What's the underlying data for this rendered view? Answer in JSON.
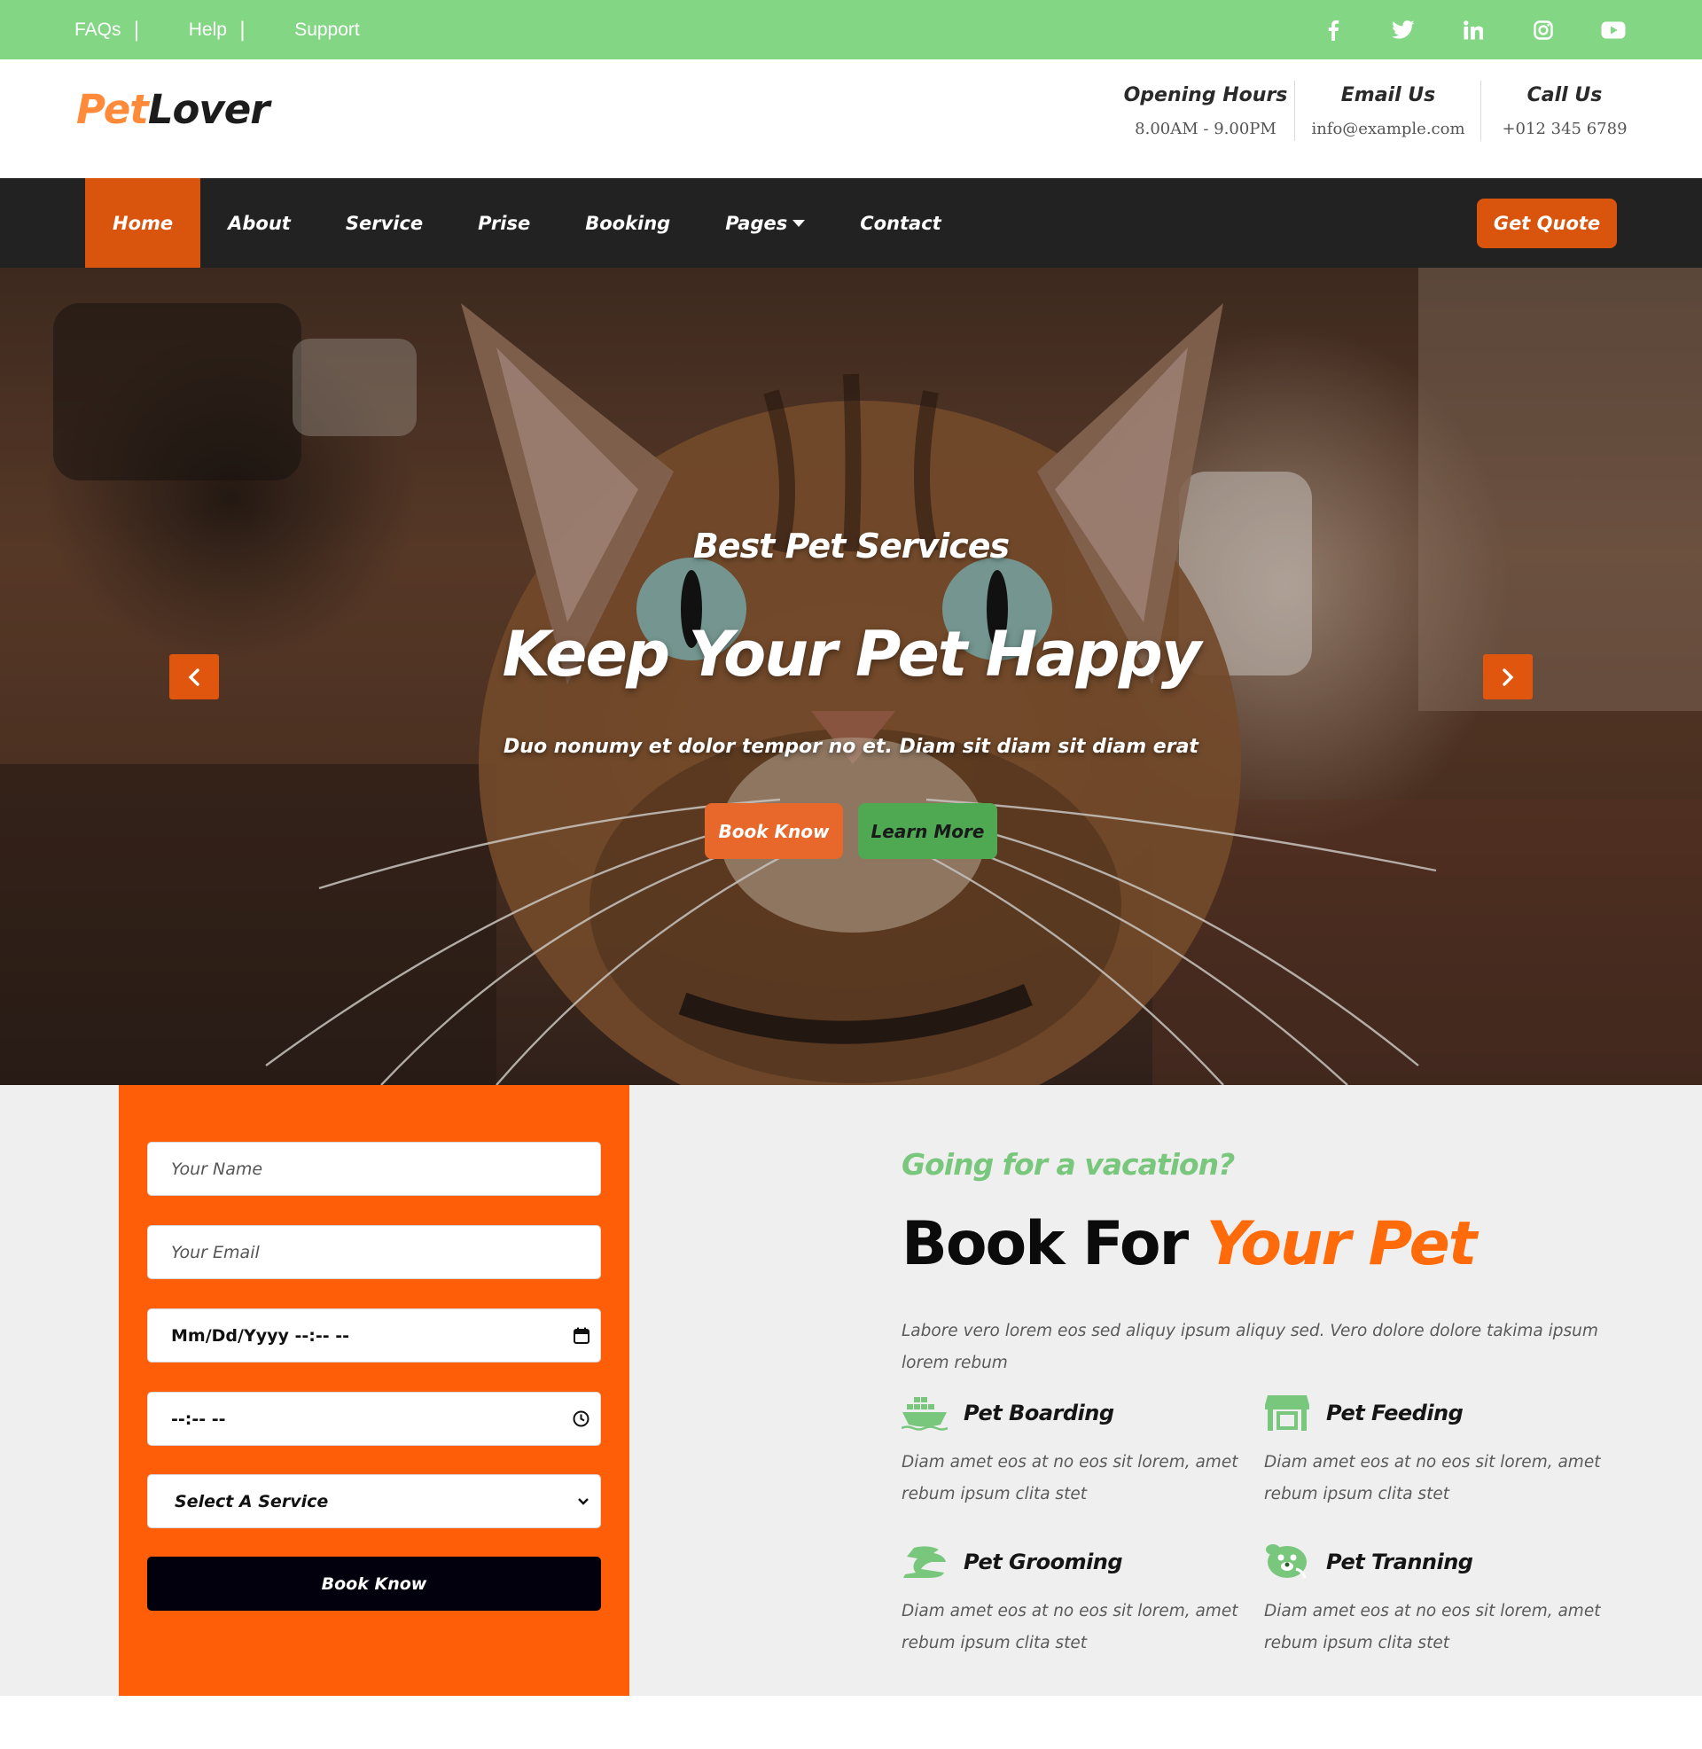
{
  "topbar": {
    "links": [
      "FAQs",
      "Help",
      "Support"
    ],
    "social_icons": [
      "facebook-icon",
      "twitter-icon",
      "linkedin-icon",
      "instagram-icon",
      "youtube-icon"
    ]
  },
  "header": {
    "logo_part1": "Pet",
    "logo_part2": "Lover",
    "contacts": [
      {
        "title": "Opening Hours",
        "value": "8.00AM - 9.00PM"
      },
      {
        "title": "Email Us",
        "value": "info@example.com"
      },
      {
        "title": "Call Us",
        "value": "+012 345 6789"
      }
    ]
  },
  "nav": {
    "items": [
      "Home",
      "About",
      "Service",
      "Prise",
      "Booking",
      "Pages",
      "Contact"
    ],
    "active": "Home",
    "quote_button": "Get Quote"
  },
  "hero": {
    "subtitle": "Best Pet Services",
    "title": "Keep Your Pet Happy",
    "description": "Duo nonumy et dolor tempor no et. Diam sit diam sit diam erat",
    "book_button": "Book Know",
    "learn_button": "Learn More"
  },
  "booking_form": {
    "name_placeholder": "Your Name",
    "email_placeholder": "Your Email",
    "date_value": "Mm/Dd/Yyyy --:-- --",
    "time_value": "--:-- --",
    "service_select": "Select A Service",
    "submit_button": "Book Know"
  },
  "booking_info": {
    "label": "Going for a vacation?",
    "title_part1": "Book For",
    "title_part2": "Your Pet",
    "description": "Labore vero lorem eos sed aliquy ipsum aliquy sed. Vero dolore dolore takima ipsum lorem rebum",
    "features": [
      {
        "title": "Pet Boarding",
        "icon": "ship-icon",
        "desc": "Diam amet eos at no eos sit lorem, amet rebum ipsum clita stet"
      },
      {
        "title": "Pet Feeding",
        "icon": "store-icon",
        "desc": "Diam amet eos at no eos sit lorem, amet rebum ipsum clita stet"
      },
      {
        "title": "Pet Grooming",
        "icon": "grooming-icon",
        "desc": "Diam amet eos at no eos sit lorem, amet rebum ipsum clita stet"
      },
      {
        "title": "Pet Tranning",
        "icon": "dog-icon",
        "desc": "Diam amet eos at no eos sit lorem, amet rebum ipsum clita stet"
      }
    ]
  },
  "colors": {
    "topbar_green": "#83d684",
    "accent_orange": "#d9550d",
    "form_orange": "#ff5e08",
    "green_text": "#79c77c",
    "dark_nav": "#222222"
  }
}
